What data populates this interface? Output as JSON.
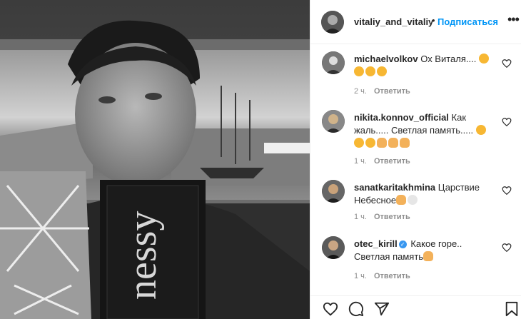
{
  "post": {
    "username": "vitaliy_and_vitaliy",
    "separator": "•",
    "follow_label": "Подписаться",
    "more_label": "•••"
  },
  "photo": {
    "box_text": "nessy"
  },
  "comments": [
    {
      "user": "michaelvolkov",
      "text": "Ох Виталя....",
      "emoji": [
        "sad-face",
        "sad-face",
        "sad-face",
        "sad-face"
      ],
      "time": "2 ч.",
      "reply": "Ответить",
      "verified": false
    },
    {
      "user": "nikita.konnov_official",
      "text": "Как жаль..... Светлая память.....",
      "emoji": [
        "crying-face",
        "crying-face",
        "crying-face",
        "folded-hands",
        "folded-hands",
        "folded-hands"
      ],
      "time": "1 ч.",
      "reply": "Ответить",
      "verified": false
    },
    {
      "user": "sanatkaritakhmina",
      "text": "Царствие Небесное",
      "emoji": [
        "folded-hands",
        "dove"
      ],
      "time": "1 ч.",
      "reply": "Ответить",
      "verified": false
    },
    {
      "user": "otec_kirill",
      "text": "Какое горе.. Светлая память",
      "emoji": [
        "folded-hands"
      ],
      "time": "1 ч.",
      "reply": "Ответить",
      "verified": true
    }
  ],
  "icons": {
    "like": "heart-icon",
    "comment": "comment-icon",
    "share": "share-icon",
    "save": "bookmark-icon"
  },
  "colors": {
    "link": "#0095f6",
    "text": "#262626",
    "muted": "#8e8e8e",
    "border": "#efefef"
  }
}
